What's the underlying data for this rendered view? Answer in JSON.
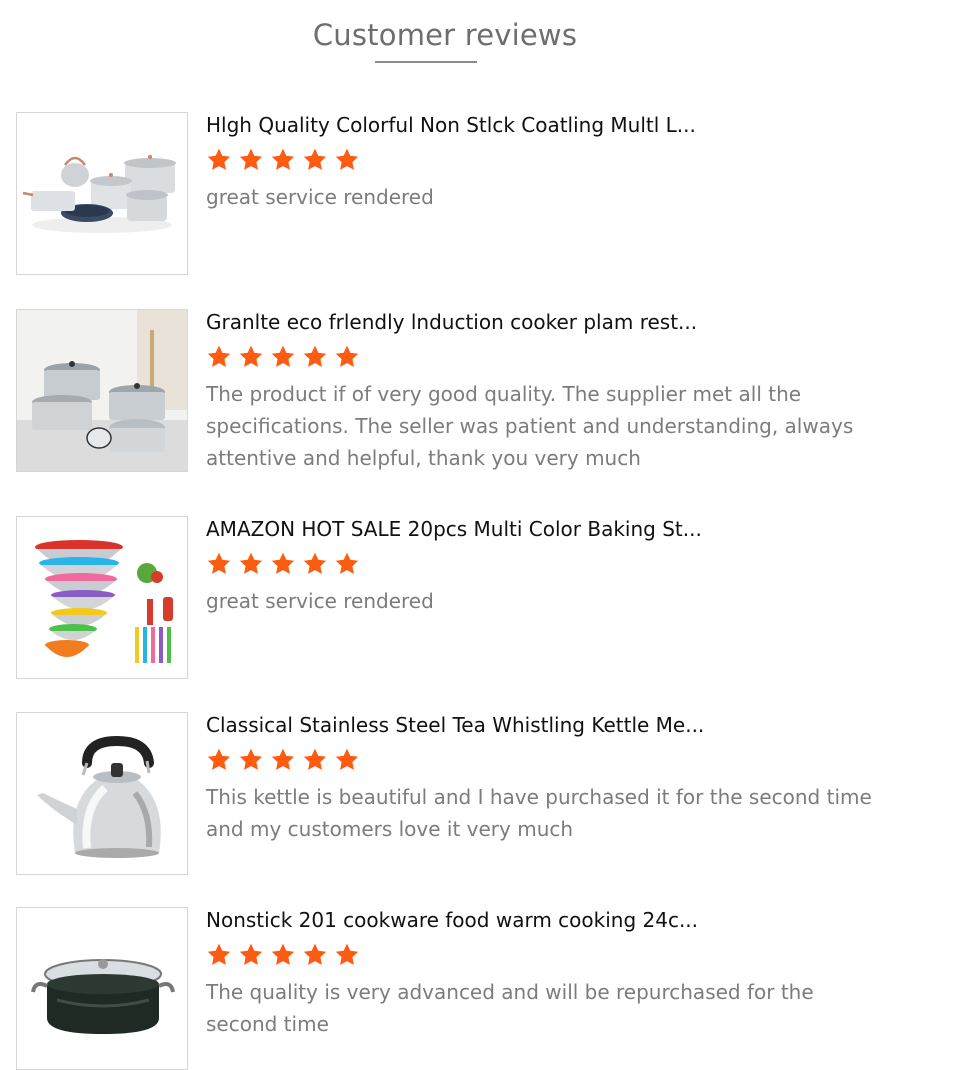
{
  "page": {
    "title": "Customer reviews"
  },
  "colors": {
    "star": "#fe5c12",
    "title": "#6e6e6e",
    "review_text": "#7c7c7c"
  },
  "reviews": [
    {
      "product_name": "Hlgh Quality Colorful Non Stlck Coatling Multl L...",
      "rating": 5,
      "text": "great service rendered",
      "image_icon": "cookware-set-image"
    },
    {
      "product_name": "Granlte eco frlendly lnduction cooker plam rest...",
      "rating": 5,
      "text": "The product if of very good quality. The supplier met all the specifications. The seller was patient and understanding, always attentive and helpful, thank you very much",
      "image_icon": "pot-set-image"
    },
    {
      "product_name": "AMAZON HOT SALE 20pcs Multi Color Baking St...",
      "rating": 5,
      "text": "great service rendered",
      "image_icon": "mixing-bowls-image"
    },
    {
      "product_name": "Classical Stainless Steel Tea Whistling Kettle Me...",
      "rating": 5,
      "text": "This kettle is beautiful and I have purchased it for the second time and my customers love it very much",
      "image_icon": "kettle-image"
    },
    {
      "product_name": "Nonstick 201 cookware food warm cooking 24c...",
      "rating": 5,
      "text": "The quality is very advanced and will be repurchased for the second time",
      "image_icon": "casserole-pot-image"
    }
  ]
}
